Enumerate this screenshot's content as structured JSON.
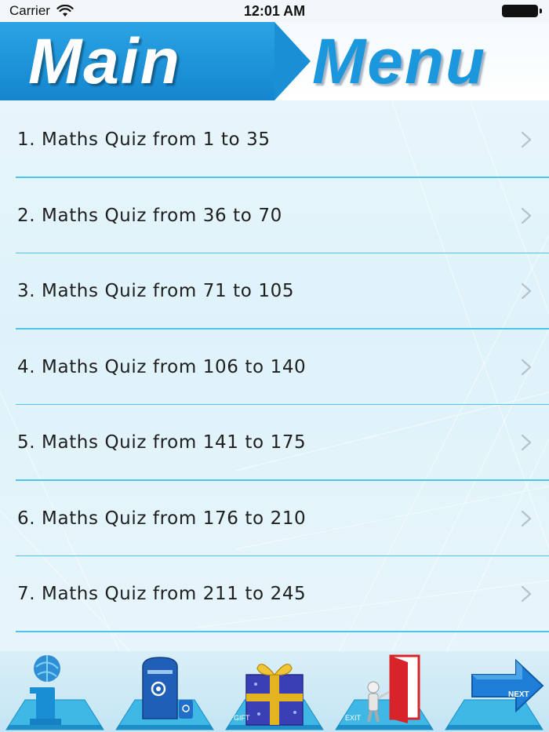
{
  "status_bar": {
    "carrier": "Carrier",
    "time": "12:01 AM"
  },
  "header": {
    "title_left": "Main",
    "title_right": "Menu"
  },
  "menu": {
    "items": [
      {
        "label": "1. Maths Quiz from 1 to 35"
      },
      {
        "label": "2. Maths Quiz from 36 to 70"
      },
      {
        "label": "3. Maths Quiz from 71 to 105"
      },
      {
        "label": "4. Maths Quiz from 106 to 140"
      },
      {
        "label": "5. Maths Quiz from 141 to 175"
      },
      {
        "label": "6. Maths Quiz from 176 to 210"
      },
      {
        "label": "7. Maths Quiz from 211 to 245"
      }
    ]
  },
  "toolbar": {
    "gift_label": "GIFT",
    "exit_label": "EXIT",
    "next_label": "NEXT"
  },
  "colors": {
    "accent_blue": "#1b97dd",
    "separator": "#4cc4ec"
  }
}
